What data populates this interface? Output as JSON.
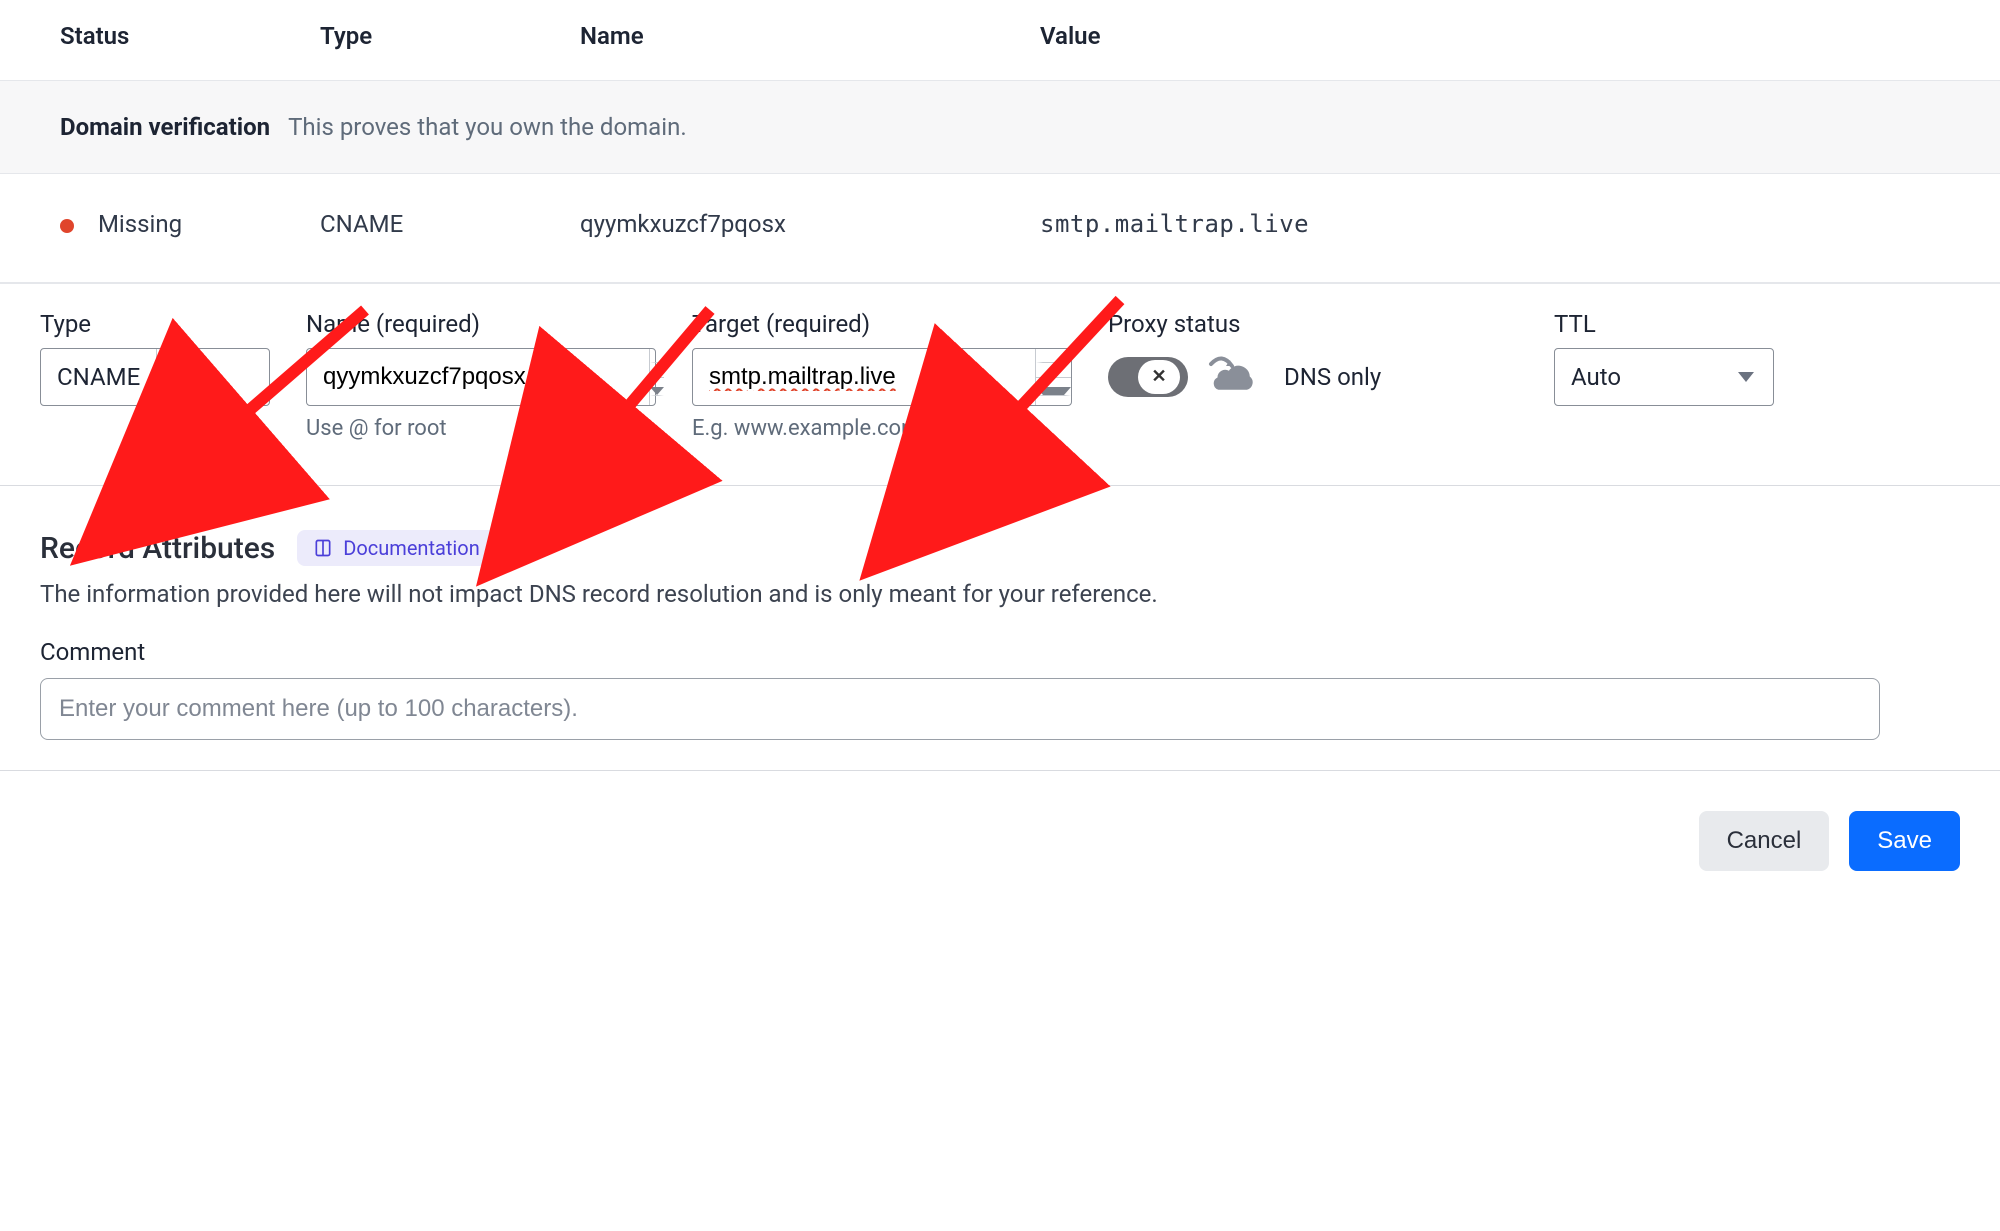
{
  "table": {
    "headers": {
      "status": "Status",
      "type": "Type",
      "name": "Name",
      "value": "Value"
    },
    "section": {
      "title": "Domain verification",
      "subtitle": "This proves that you own the domain."
    },
    "row": {
      "status": "Missing",
      "type": "CNAME",
      "name": "qyymkxuzcf7pqosx",
      "value": "smtp.mailtrap.live"
    }
  },
  "form": {
    "type": {
      "label": "Type",
      "value": "CNAME"
    },
    "name": {
      "label": "Name (required)",
      "value": "qyymkxuzcf7pqosx",
      "hint": "Use @ for root"
    },
    "target": {
      "label": "Target (required)",
      "value": "smtp.mailtrap.live",
      "hint": "E.g. www.example.com"
    },
    "proxy": {
      "label": "Proxy status",
      "state_text": "DNS only",
      "enabled": false
    },
    "ttl": {
      "label": "TTL",
      "value": "Auto"
    }
  },
  "attributes": {
    "heading": "Record Attributes",
    "doc_label": "Documentation",
    "description": "The information provided here will not impact DNS record resolution and is only meant for your reference.",
    "comment_label": "Comment",
    "comment_placeholder": "Enter your comment here (up to 100 characters).",
    "comment_value": ""
  },
  "footer": {
    "cancel": "Cancel",
    "save": "Save"
  }
}
